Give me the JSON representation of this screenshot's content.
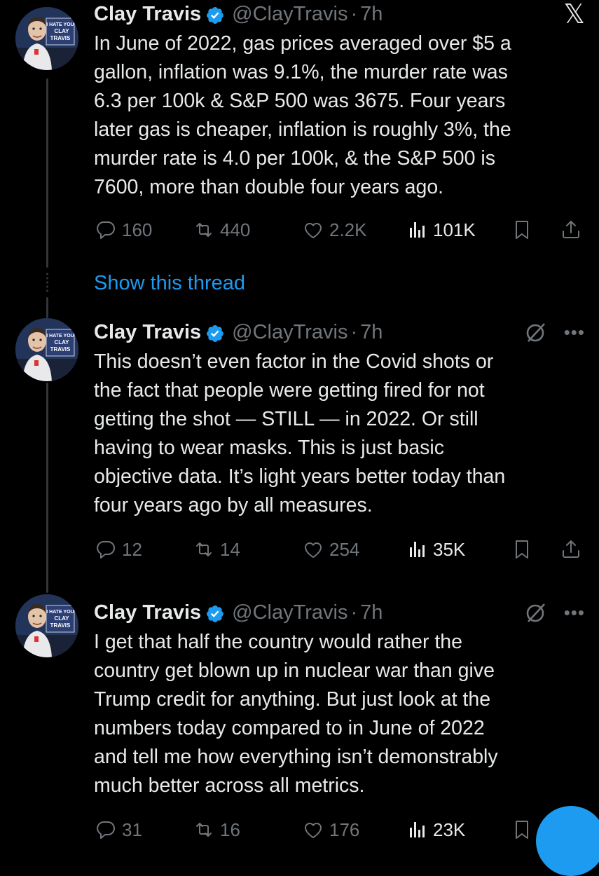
{
  "colors": {
    "background": "#000000",
    "text": "#e7e9ea",
    "muted": "#71767b",
    "accent": "#1d9bf0",
    "line": "#333639"
  },
  "show_thread_label": "Show this thread",
  "avatar_sign_text": "I HATE YOU CLAY TRAVIS",
  "tweets": [
    {
      "name": "Clay Travis",
      "handle": "@ClayTravis",
      "separator": "·",
      "time": "7h",
      "header_icon": "x-logo-icon",
      "text": "In June of 2022, gas prices averaged over $5 a\ngallon, inflation was 9.1%, the murder rate was\n6.3 per 100k & S&P 500 was 3675. Four years\nlater gas is cheaper,  inflation is roughly 3%, the\nmurder rate is 4.0 per 100k, & the S&P 500 is\n7600, more than double four years ago.",
      "replies": "160",
      "reposts": "440",
      "likes": "2.2K",
      "views": "101K"
    },
    {
      "name": "Clay Travis",
      "handle": "@ClayTravis",
      "separator": "·",
      "time": "7h",
      "header_icon": "grok-icon",
      "text": "This doesn’t even factor in the Covid shots or\nthe fact that people were getting fired for not\ngetting the shot — STILL — in 2022. Or still\nhaving to wear masks. This is just basic\nobjective data. It’s light years better today than\nfour years ago by all measures.",
      "replies": "12",
      "reposts": "14",
      "likes": "254",
      "views": "35K"
    },
    {
      "name": "Clay Travis",
      "handle": "@ClayTravis",
      "separator": "·",
      "time": "7h",
      "header_icon": "grok-icon",
      "text": "I get that half the country would rather the\ncountry get blown up in nuclear war than give\nTrump credit for anything. But just look at the\nnumbers today compared to in June of 2022\nand tell me how everything isn’t demonstrably\nmuch better across all metrics.",
      "replies": "31",
      "reposts": "16",
      "likes": "176",
      "views": "23K"
    }
  ]
}
